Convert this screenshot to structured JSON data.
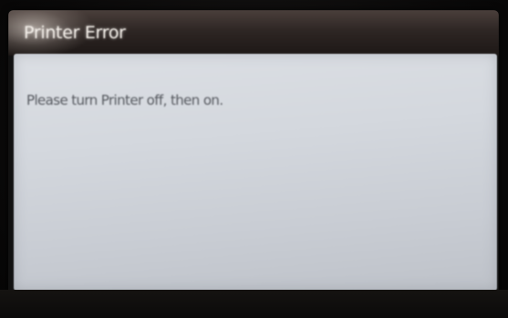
{
  "dialog": {
    "title": "Printer Error",
    "message": "Please turn Printer off, then on."
  },
  "colors": {
    "title_bar": "#2e2624",
    "title_text": "#f4efe9",
    "panel": "#d4d8de",
    "message_text": "#55585e",
    "bezel": "#0c0b0b"
  }
}
